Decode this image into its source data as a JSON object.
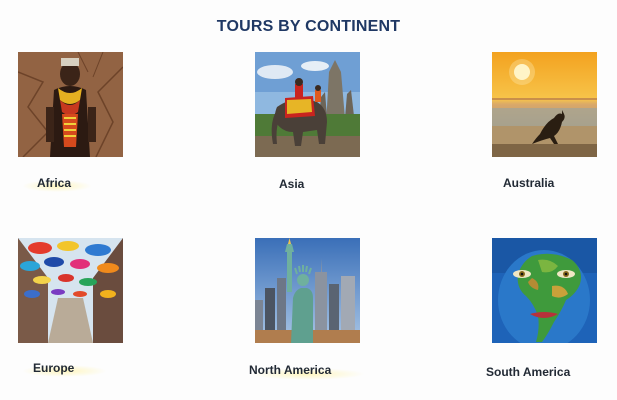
{
  "page": {
    "title": "TOURS BY CONTINENT"
  },
  "continents": [
    {
      "label": "Africa",
      "image": "african-tribal-warrior-photo"
    },
    {
      "label": "Asia",
      "image": "elephant-angkor-temple-photo"
    },
    {
      "label": "Australia",
      "image": "kangaroo-sunset-beach-photo"
    },
    {
      "label": "Europe",
      "image": "colorful-umbrellas-street-photo"
    },
    {
      "label": "North America",
      "image": "statue-of-liberty-skyline-photo"
    },
    {
      "label": "South America",
      "image": "face-painted-continent-photo"
    }
  ]
}
